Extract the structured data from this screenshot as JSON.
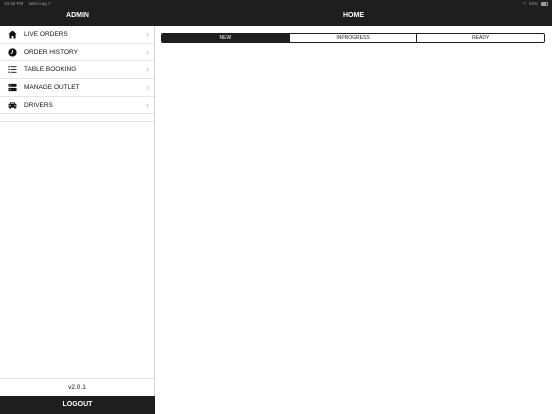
{
  "status_bar": {
    "time": "10:40 PM",
    "date": "Wed Aug 7",
    "battery": "53%"
  },
  "sidebar": {
    "title": "ADMIN",
    "items": [
      {
        "label": "LIVE ORDERS",
        "icon": "home-icon"
      },
      {
        "label": "ORDER HISTORY",
        "icon": "clock-icon"
      },
      {
        "label": "TABLE BOOKING",
        "icon": "list-icon"
      },
      {
        "label": "MANAGE OUTLET",
        "icon": "outlet-icon"
      },
      {
        "label": "DRIVERS",
        "icon": "car-icon"
      }
    ],
    "chevron": "›",
    "version": "v2.0.1",
    "logout_label": "LOGOUT"
  },
  "main": {
    "title": "HOME",
    "tabs": [
      {
        "label": "NEW",
        "active": true
      },
      {
        "label": "INPROGRESS",
        "active": false
      },
      {
        "label": "READY",
        "active": false
      }
    ]
  },
  "colors": {
    "header_bg": "#1e1e1e",
    "divider": "#e4e4e4",
    "chevron": "#b5b5b5"
  }
}
